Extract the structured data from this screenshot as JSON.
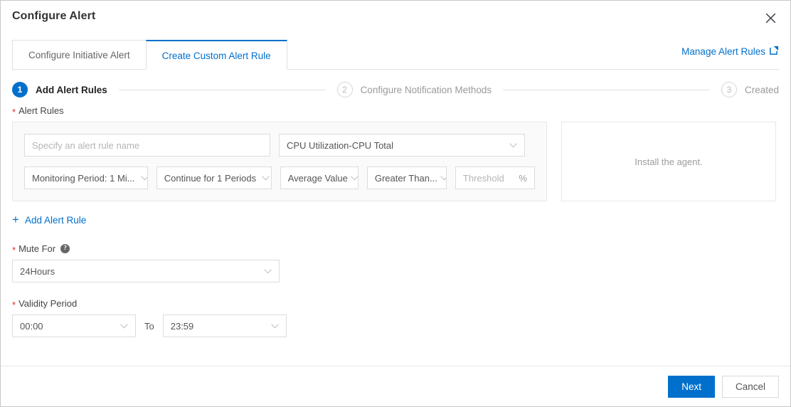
{
  "dialog": {
    "title": "Configure Alert",
    "close_icon": "close-icon"
  },
  "tabs": [
    {
      "label": "Configure Initiative Alert",
      "active": false
    },
    {
      "label": "Create Custom Alert Rule",
      "active": true
    }
  ],
  "manage_link": {
    "label": "Manage Alert Rules",
    "icon": "external-link-icon"
  },
  "steps": [
    {
      "num": "1",
      "label": "Add Alert Rules",
      "state": "done"
    },
    {
      "num": "2",
      "label": "Configure Notification Methods",
      "state": "todo"
    },
    {
      "num": "3",
      "label": "Created",
      "state": "todo"
    }
  ],
  "alert_rules": {
    "label": "Alert Rules",
    "required": "*",
    "rule_name": {
      "placeholder": "Specify an alert rule name",
      "value": ""
    },
    "metric": {
      "value": "CPU Utilization-CPU Total"
    },
    "monitoring_period": {
      "value": "Monitoring Period: 1 Mi..."
    },
    "continue_periods": {
      "value": "Continue for 1 Periods"
    },
    "statistic": {
      "value": "Average Value"
    },
    "comparison": {
      "value": "Greater Than..."
    },
    "threshold": {
      "placeholder": "Threshold",
      "value": "",
      "unit": "%"
    },
    "add_rule_label": "Add Alert Rule",
    "add_rule_icon": "plus-icon"
  },
  "agent_panel": {
    "message": "Install the agent."
  },
  "mute_for": {
    "label": "Mute For",
    "required": "*",
    "help_icon": "question-mark-icon",
    "value": "24Hours"
  },
  "validity_period": {
    "label": "Validity Period",
    "required": "*",
    "start": "00:00",
    "separator": "To",
    "end": "23:59"
  },
  "footer": {
    "next_label": "Next",
    "cancel_label": "Cancel"
  },
  "colors": {
    "accent": "#0070cc",
    "required": "#d93026",
    "card_bg": "#fafafa",
    "border": "#e0e0e0"
  }
}
